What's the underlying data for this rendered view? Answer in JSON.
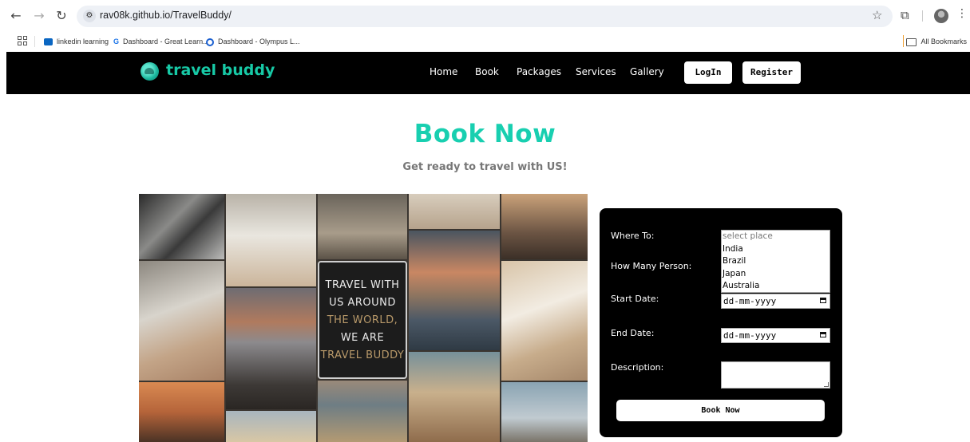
{
  "browser": {
    "url": "rav08k.github.io/TravelBuddy/",
    "bookmarks": [
      {
        "label": "linkedin learning",
        "color": "#0a66c2"
      },
      {
        "label": "Dashboard - Great Learn...",
        "color": "#1a73e8"
      },
      {
        "label": "Dashboard - Olympus L...",
        "color": "#1a5fd0"
      }
    ],
    "all_bookmarks_label": "All Bookmarks"
  },
  "site": {
    "logo_text": "travel buddy",
    "nav": {
      "links": [
        "Home",
        "Book",
        "Packages",
        "Services",
        "Gallery"
      ],
      "login_label": "LogIn",
      "register_label": "Register"
    },
    "heading": "Book Now",
    "subheading": "Get ready to travel with US!",
    "collage": {
      "quote_lines": [
        "TRAVEL WITH",
        "US AROUND",
        "THE WORLD,",
        "WE ARE",
        "TRAVEL BUDDY"
      ]
    },
    "form": {
      "where_label": "Where To:",
      "persons_label": "How Many Person:",
      "start_label": "Start Date:",
      "end_label": "End Date:",
      "description_label": "Description:",
      "place_placeholder": "select place",
      "place_options": [
        "India",
        "Brazil",
        "Japan",
        "Australia"
      ],
      "start_value": "dd-mm-yyyy",
      "end_value": "dd-mm-yyyy",
      "submit_label": "Book Now"
    }
  },
  "colors": {
    "accent": "#18cfb0",
    "nav_bg": "#000000",
    "subheading": "#777777"
  }
}
